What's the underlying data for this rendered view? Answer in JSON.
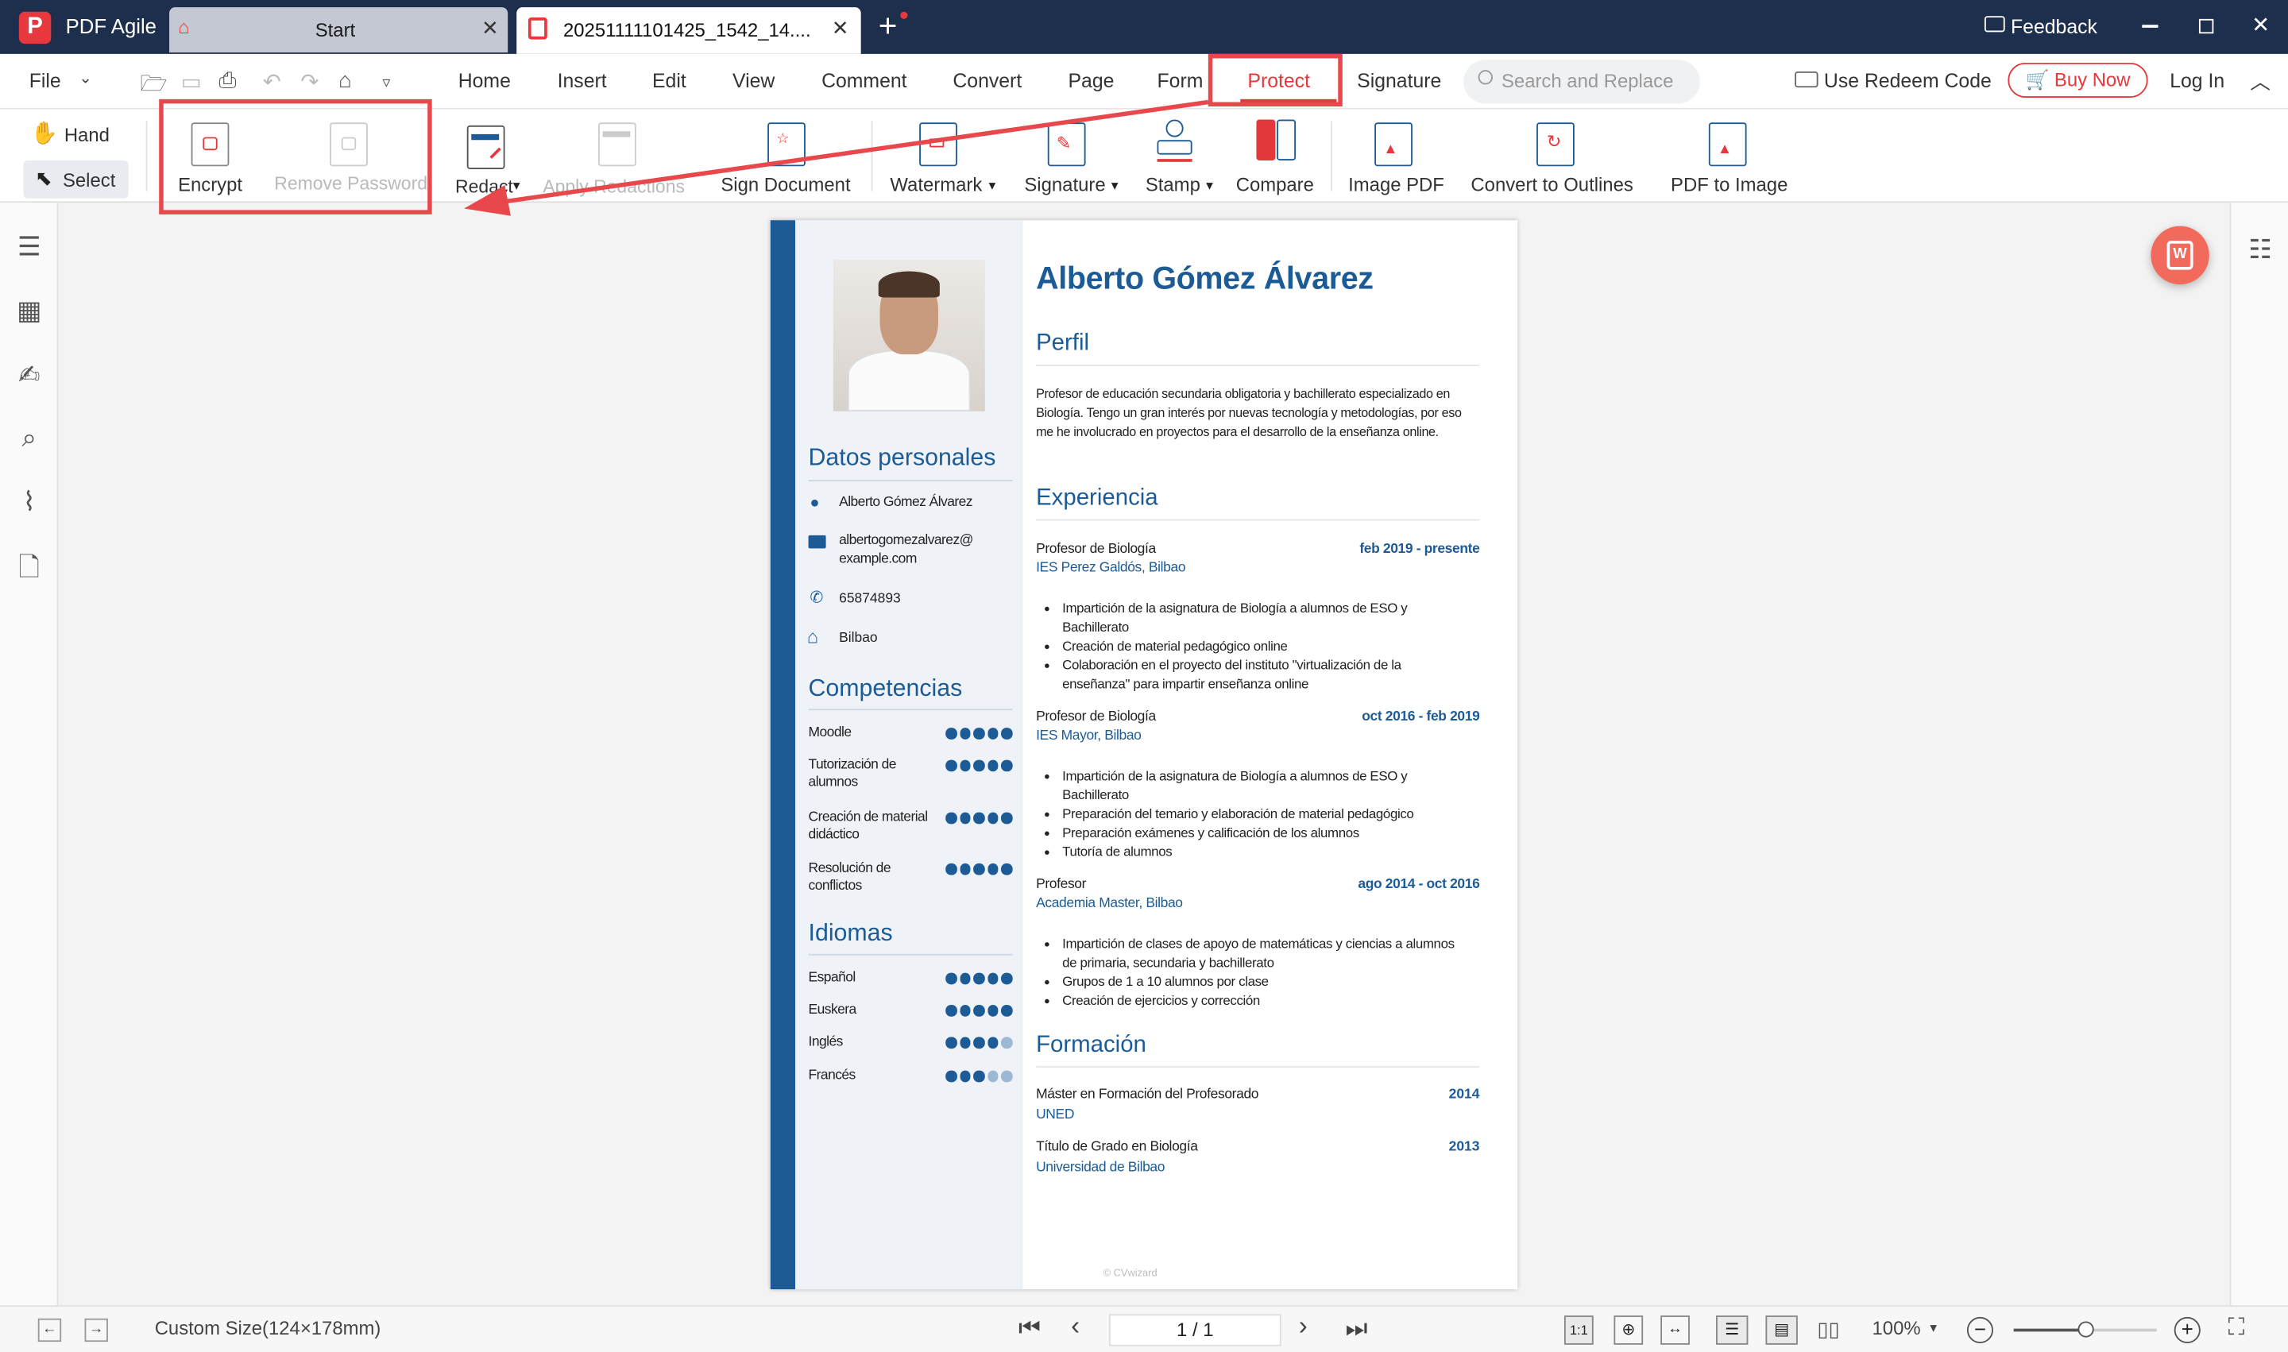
{
  "app": {
    "name": "PDF Agile",
    "logo": "P"
  },
  "tabs": [
    {
      "label": "Start"
    },
    {
      "label": "20251111101425_1542_14...."
    }
  ],
  "titlebar": {
    "feedback": "Feedback"
  },
  "menubar": {
    "file": "File",
    "items": [
      "Home",
      "Insert",
      "Edit",
      "View",
      "Comment",
      "Convert",
      "Page",
      "Form",
      "Protect",
      "Signature"
    ],
    "active": "Protect",
    "search_placeholder": "Search and Replace",
    "redeem": "Use Redeem Code",
    "buy_now": "Buy Now",
    "login": "Log In"
  },
  "ribbon": {
    "hand": "Hand",
    "select": "Select",
    "encrypt": "Encrypt",
    "remove_password": "Remove Password",
    "redact": "Redact",
    "apply_redactions": "Apply Redactions",
    "sign_document": "Sign Document",
    "watermark": "Watermark",
    "signature": "Signature",
    "stamp": "Stamp",
    "compare": "Compare",
    "image_pdf": "Image PDF",
    "convert_outlines": "Convert to Outlines",
    "pdf_to_image": "PDF to Image"
  },
  "document": {
    "name": "Alberto Gómez Álvarez",
    "left": {
      "datos_heading": "Datos personales",
      "contact_name": "Alberto Gómez Álvarez",
      "email_1": "albertogomezalvarez@",
      "email_2": "example.com",
      "phone": "65874893",
      "city": "Bilbao",
      "competencias_heading": "Competencias",
      "skills": [
        {
          "name": "Moodle",
          "level": 5
        },
        {
          "name": "Tutorización de alumnos",
          "level": 5
        },
        {
          "name": "Creación de material didáctico",
          "level": 5
        },
        {
          "name": "Resolución de conflictos",
          "level": 5
        }
      ],
      "idiomas_heading": "Idiomas",
      "languages": [
        {
          "name": "Español",
          "level": 5
        },
        {
          "name": "Euskera",
          "level": 5
        },
        {
          "name": "Inglés",
          "level": 4
        },
        {
          "name": "Francés",
          "level": 3
        }
      ]
    },
    "perfil_heading": "Perfil",
    "perfil_text": "Profesor de educación secundaria obligatoria y bachillerato especializado en Biología. Tengo un gran interés por nuevas tecnología y metodologías, por eso me he involucrado en proyectos para el desarrollo de la enseñanza online.",
    "experiencia_heading": "Experiencia",
    "jobs": [
      {
        "title": "Profesor de Biología",
        "place": "IES Perez Galdós, Bilbao",
        "date": "feb 2019 - presente",
        "bullets": [
          "Impartición de la asignatura de Biología a alumnos de ESO y Bachillerato",
          "Creación de material pedagógico online",
          "Colaboración en el proyecto del instituto \"virtualización de la enseñanza\" para impartir enseñanza online"
        ]
      },
      {
        "title": "Profesor de Biología",
        "place": "IES Mayor, Bilbao",
        "date": "oct 2016 - feb 2019",
        "bullets": [
          "Impartición de la asignatura de Biología a alumnos de ESO y Bachillerato",
          "Preparación del temario y elaboración de material pedagógico",
          "Preparación exámenes y calificación de los alumnos",
          "Tutoría de alumnos"
        ]
      },
      {
        "title": "Profesor",
        "place": "Academia Master, Bilbao",
        "date": "ago 2014 - oct 2016",
        "bullets": [
          "Impartición de clases de apoyo de matemáticas y ciencias a alumnos de primaria, secundaria y bachillerato",
          "Grupos de 1 a 10 alumnos por clase",
          "Creación de ejercicios y corrección"
        ]
      }
    ],
    "formacion_heading": "Formación",
    "education": [
      {
        "title": "Máster en Formación del Profesorado",
        "place": "UNED",
        "date": "2014"
      },
      {
        "title": "Título de Grado en Biología",
        "place": "Universidad de Bilbao",
        "date": "2013"
      }
    ],
    "footer": "© CVwizard"
  },
  "status": {
    "size": "Custom Size(124×178mm)",
    "page": "1 / 1",
    "zoom": "100%",
    "zoom_fraction": 0.5
  },
  "colors": {
    "titlebar": "#1e2f4e",
    "accent": "#e5383b",
    "doc_blue": "#1c5b96"
  }
}
